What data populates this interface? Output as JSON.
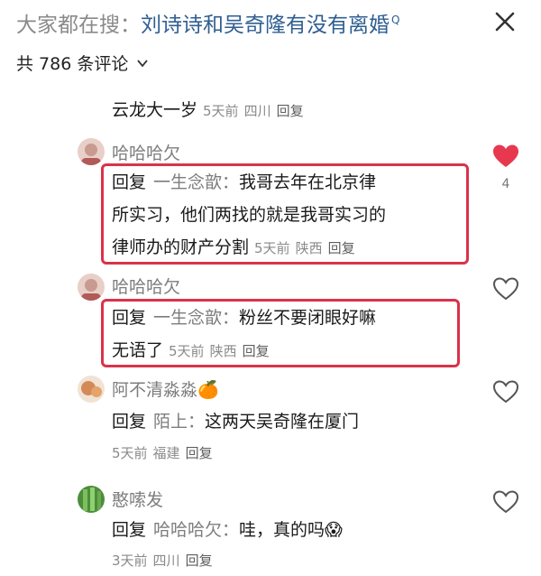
{
  "header": {
    "search_prefix": "大家都在搜：",
    "search_topic": "刘诗诗和吴奇隆有没有离婚",
    "comment_count_label": "共 786 条评论"
  },
  "colors": {
    "highlight": "#d9334a",
    "link": "#2f5e92",
    "like_active": "#e8384f"
  },
  "comments": [
    {
      "text": "云龙大一岁",
      "time": "5天前",
      "location": "四川",
      "reply": "回复"
    },
    {
      "username": "哈哈哈欠",
      "reply_word": "回复",
      "reply_to": "一生念歆：",
      "text_line1": "我哥去年在北京律",
      "text_line2": "所实习，他们两找的就是我哥实习的",
      "text_line3": "律师办的财产分割",
      "time": "5天前",
      "location": "陕西",
      "reply": "回复",
      "likes": "4",
      "liked": true
    },
    {
      "username": "哈哈哈欠",
      "reply_word": "回复",
      "reply_to": "一生念歆：",
      "text_line1": "粉丝不要闭眼好嘛",
      "text_line2": "无语了",
      "time": "5天前",
      "location": "陕西",
      "reply": "回复"
    },
    {
      "username": "阿不清淼淼",
      "username_emoji": "🍊",
      "reply_word": "回复",
      "reply_to": "陌上：",
      "text_line1": "这两天吴奇隆在厦门",
      "time": "5天前",
      "location": "福建",
      "reply": "回复"
    },
    {
      "username": "憨嗦发",
      "reply_word": "回复",
      "reply_to": "哈哈哈欠：",
      "text_line1": "哇，真的吗",
      "text_emoji": "😱",
      "time": "3天前",
      "location": "四川",
      "reply": "回复"
    }
  ]
}
